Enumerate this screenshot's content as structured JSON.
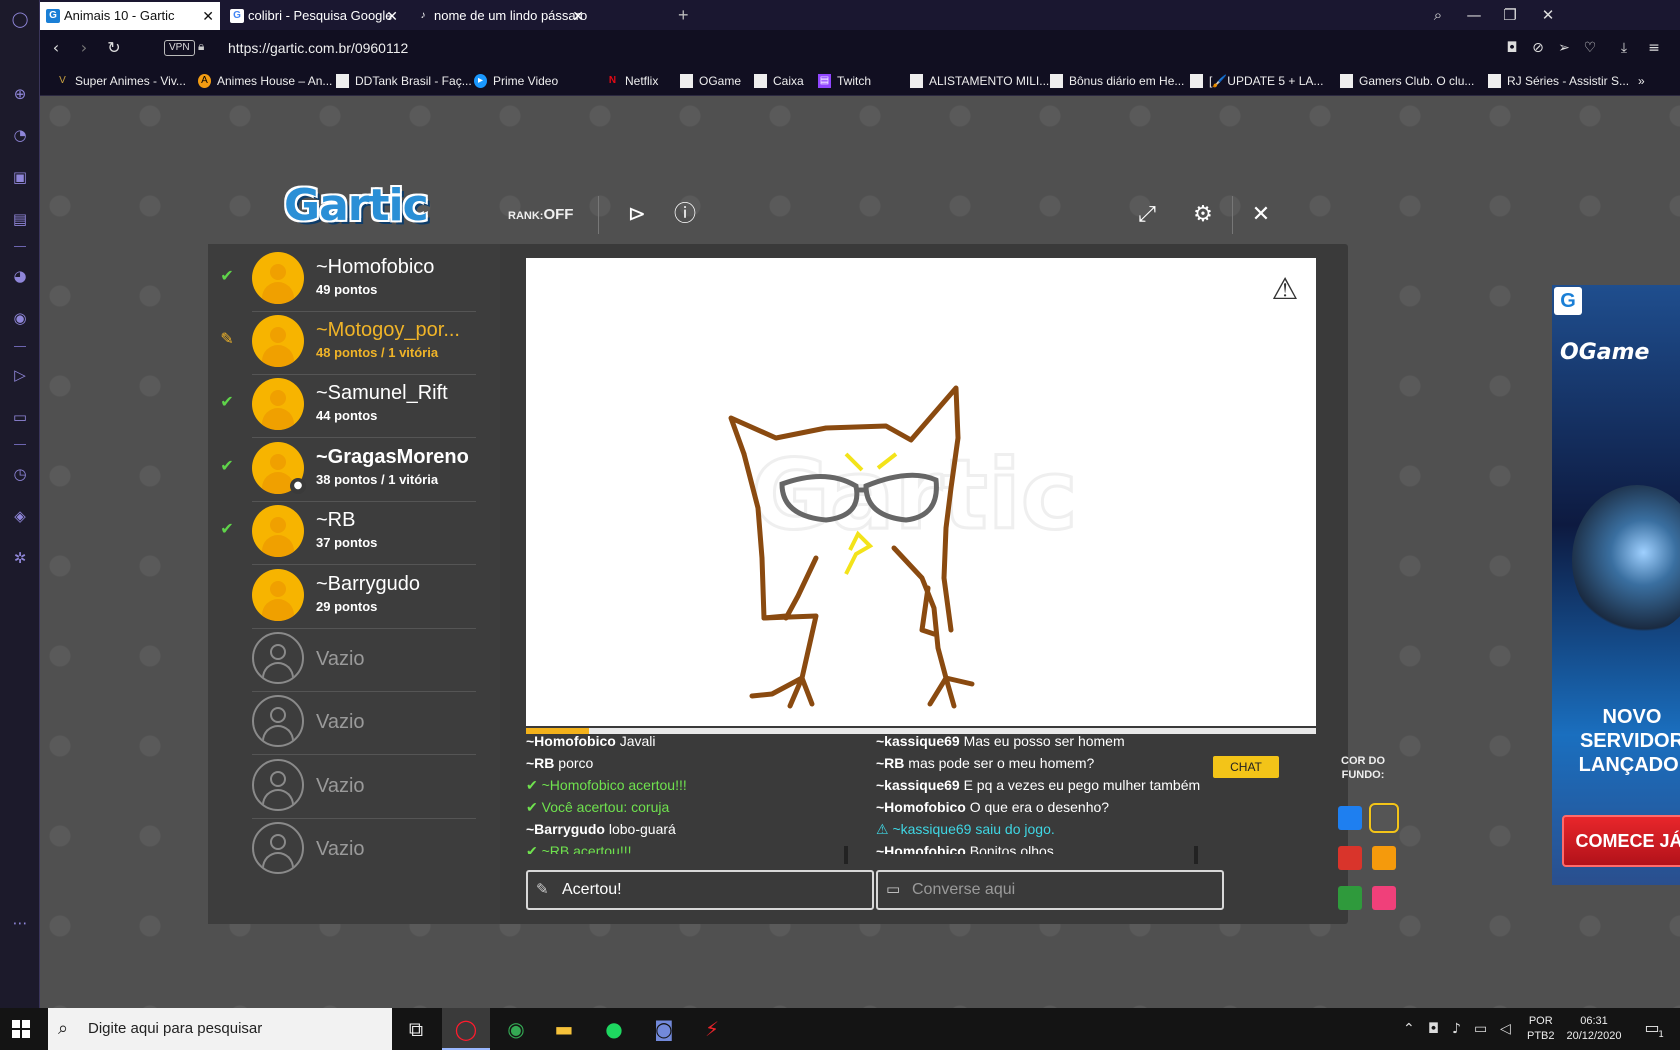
{
  "browser": {
    "tabs": [
      {
        "label": "Animais 10 - Gartic",
        "favicon": "G"
      },
      {
        "label": "colibri - Pesquisa Google",
        "favicon": "G"
      },
      {
        "label": "nome de um lindo pássaro",
        "favicon": "♪"
      }
    ],
    "new_tab": "+",
    "vpn": "VPN",
    "url": "https://gartic.com.br/0960112",
    "bookmarks": [
      "Super Animes - Viv...",
      "Animes House – An...",
      "DDTank Brasil - Faç...",
      "Prime Video",
      "Netflix",
      "OGame",
      "Caixa",
      "Twitch",
      "ALISTAMENTO MILI...",
      "Bônus diário em He...",
      "[🖌️UPDATE 5 + LA...",
      "Gamers Club. O clu...",
      "RJ Séries - Assistir S..."
    ],
    "bookmarks_more": "»"
  },
  "game": {
    "logo": "Gartic",
    "rank_label": "RANK:",
    "rank_value": "OFF",
    "players": [
      {
        "name": "~Homofobico",
        "points": "49 pontos",
        "status": "check"
      },
      {
        "name": "~Motogoy_por...",
        "points": "48 pontos / 1 vitória",
        "status": "pencil"
      },
      {
        "name": "~Samunel_Rift",
        "points": "44 pontos",
        "status": "check"
      },
      {
        "name": "~GragasMoreno",
        "points": "38 pontos / 1 vitória",
        "status": "check"
      },
      {
        "name": "~RB",
        "points": "37 pontos",
        "status": "check"
      },
      {
        "name": "~Barrygudo",
        "points": "29 pontos",
        "status": ""
      }
    ],
    "empty_slot": "Vazio",
    "timer_progress": 0.08,
    "answers": [
      {
        "who": "~Homofobico",
        "text": "Javali",
        "type": "msg"
      },
      {
        "who": "~RB",
        "text": "porco",
        "type": "msg"
      },
      {
        "who": "",
        "text": "~Homofobico acertou!!!",
        "type": "hit"
      },
      {
        "who": "",
        "text": "Você acertou: coruja",
        "type": "hit"
      },
      {
        "who": "~Barrygudo",
        "text": "lobo-guará",
        "type": "msg"
      },
      {
        "who": "",
        "text": "~RB acertou!!!",
        "type": "hit"
      }
    ],
    "answer_input_value": "Acertou!",
    "chat": [
      {
        "who": "~kassique69",
        "text": "Mas eu posso ser homem",
        "type": "msg"
      },
      {
        "who": "~RB",
        "text": "mas pode ser o meu homem?",
        "type": "msg"
      },
      {
        "who": "~kassique69",
        "text": "E pq a vezes eu pego mulher também",
        "type": "msg"
      },
      {
        "who": "~Homofobico",
        "text": "O que era o desenho?",
        "type": "msg"
      },
      {
        "who": "",
        "text": "~kassique69 saiu do jogo.",
        "type": "sys"
      },
      {
        "who": "~Homofobico",
        "text": "Bonitos olhos.",
        "type": "msg"
      }
    ],
    "chat_placeholder": "Converse aqui",
    "chat_toggle": "CHAT",
    "bg_color_label": "COR DO FUNDO:",
    "bg_colors": [
      "#1e7ff0",
      "#555555",
      "#d9342b",
      "#f59a0c",
      "#2f9a3c",
      "#f0407a"
    ],
    "watermark": "Gartic"
  },
  "ad": {
    "brand": "OGame",
    "headline": "NOVO SERVIDOR LANÇADO!",
    "cta": "COMECE JÁ!"
  },
  "taskbar": {
    "search_placeholder": "Digite aqui para pesquisar",
    "lang": "POR",
    "layout": "PTB2",
    "time": "06:31",
    "date": "20/12/2020",
    "notifications": "1"
  }
}
